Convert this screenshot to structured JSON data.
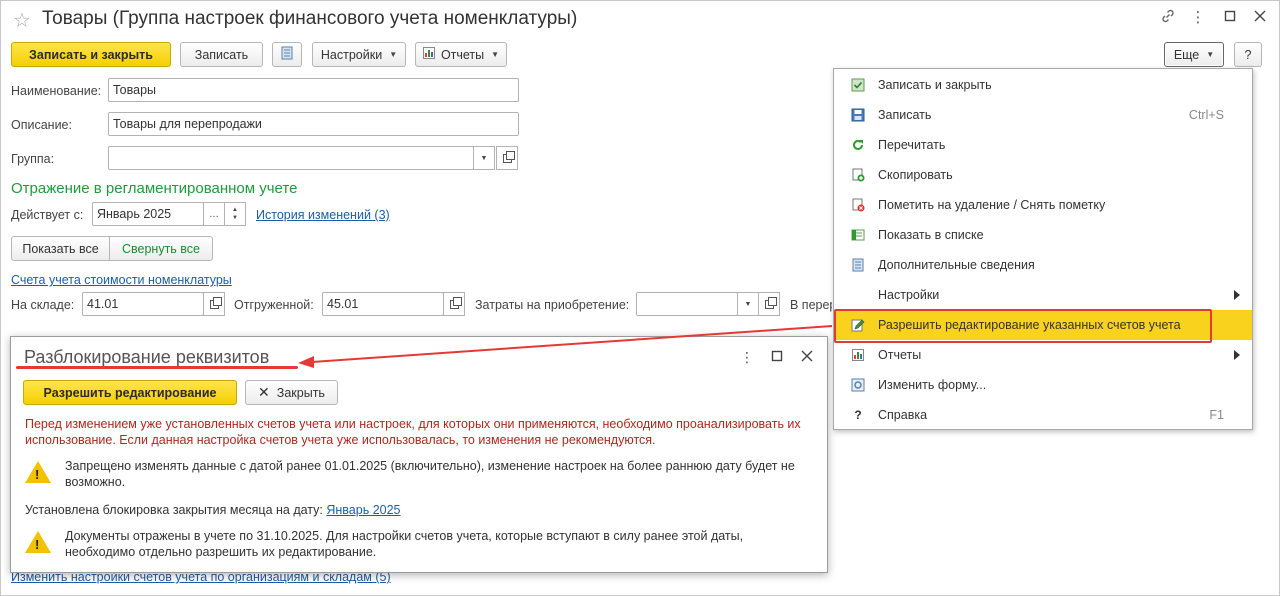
{
  "window": {
    "title": "Товары (Группа настроек финансового учета номенклатуры)"
  },
  "toolbar": {
    "save_close": "Записать и закрыть",
    "save": "Записать",
    "settings": "Настройки",
    "reports": "Отчеты",
    "more": "Еще",
    "help": "?"
  },
  "form": {
    "name_label": "Наименование:",
    "name_value": "Товары",
    "desc_label": "Описание:",
    "desc_value": "Товары для перепродажи",
    "group_label": "Группа:",
    "group_value": "",
    "section_title": "Отражение в регламентированном учете",
    "effective_label": "Действует с:",
    "effective_value": "Январь 2025",
    "history_link": "История изменений (3)",
    "show_all": "Показать все",
    "collapse_all": "Свернуть все",
    "accounts_link": "Счета учета стоимости номенклатуры",
    "warehouse_label": "На складе:",
    "warehouse_value": "41.01",
    "shipped_label": "Отгруженной:",
    "shipped_value": "45.01",
    "costs_label": "Затраты на приобретение:",
    "costs_value": "",
    "cut_label": "В перер",
    "bottom_link": "Изменить настройки счетов учета по организациям и складам (5)"
  },
  "menu": {
    "items": [
      {
        "label": "Записать и закрыть",
        "icon": "save-close-icon",
        "shortcut": ""
      },
      {
        "label": "Записать",
        "icon": "floppy-icon",
        "shortcut": "Ctrl+S"
      },
      {
        "label": "Перечитать",
        "icon": "refresh-icon",
        "shortcut": ""
      },
      {
        "label": "Скопировать",
        "icon": "copy-icon",
        "shortcut": ""
      },
      {
        "label": "Пометить на удаление / Снять пометку",
        "icon": "mark-delete-icon",
        "shortcut": ""
      },
      {
        "label": "Показать в списке",
        "icon": "show-in-list-icon",
        "shortcut": ""
      },
      {
        "label": "Дополнительные сведения",
        "icon": "details-icon",
        "shortcut": ""
      },
      {
        "label": "Настройки",
        "icon": "",
        "shortcut": ""
      },
      {
        "label": "Разрешить редактирование указанных счетов учета",
        "icon": "edit-pencil-icon",
        "shortcut": ""
      },
      {
        "label": "Отчеты",
        "icon": "report-icon",
        "shortcut": ""
      },
      {
        "label": "Изменить форму...",
        "icon": "form-settings-icon",
        "shortcut": ""
      },
      {
        "label": "Справка",
        "icon": "help-icon",
        "shortcut": "F1"
      }
    ]
  },
  "dialog": {
    "title": "Разблокирование реквизитов",
    "allow_button": "Разрешить редактирование",
    "close_button": "Закрыть",
    "warning": "Перед изменением уже установленных счетов учета или настроек, для которых они применяются, необходимо проанализировать их использование. Если данная настройка счетов учета уже использовалась, то изменения не рекомендуются.",
    "note1": "Запрещено изменять данные с датой ранее 01.01.2025 (включительно), изменение настроек на более раннюю дату будет не возможно.",
    "lock_label": "Установлена блокировка закрытия месяца на дату: ",
    "lock_link": "Январь 2025",
    "note2": "Документы отражены в учете по 31.10.2025. Для настройки счетов учета, которые вступают в силу ранее этой даты, необходимо отдельно разрешить их редактирование."
  },
  "colors": {
    "accent_yellow": "#f5cf00",
    "section_green": "#1f9c3c",
    "link_blue": "#1c5ea8",
    "warning_red": "#b3261e",
    "highlight_red": "#e53935"
  }
}
